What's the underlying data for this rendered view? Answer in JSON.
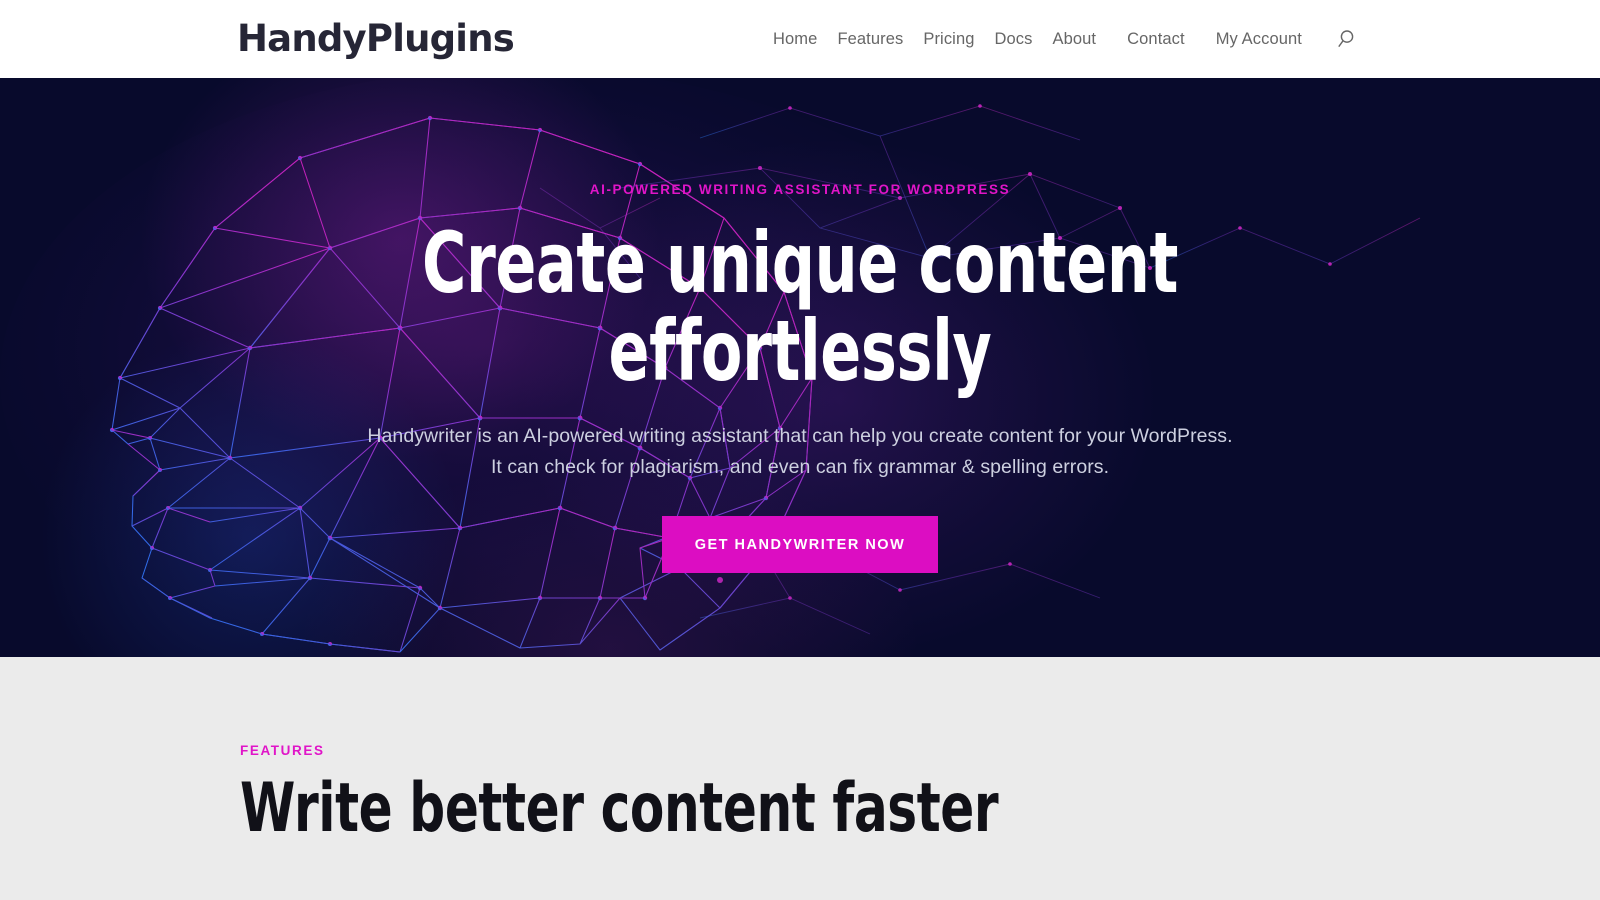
{
  "header": {
    "brand": "HandyPlugins",
    "nav": [
      {
        "label": "Home"
      },
      {
        "label": "Features"
      },
      {
        "label": "Pricing"
      },
      {
        "label": "Docs"
      },
      {
        "label": "About"
      },
      {
        "label": "Contact"
      },
      {
        "label": "My Account"
      }
    ],
    "search_icon": "search-icon"
  },
  "hero": {
    "eyebrow": "AI-POWERED WRITING ASSISTANT FOR WORDPRESS",
    "title_line1": "Create unique content",
    "title_line2": "effortlessly",
    "sub_line1": "Handywriter is an AI-powered writing assistant that can help you create content for your WordPress.",
    "sub_line2": "It can check for plagiarism, and even can fix grammar & spelling errors.",
    "cta_label": "GET HANDYWRITER NOW",
    "background_art": "low-poly-wireframe-human-head-profile"
  },
  "features": {
    "eyebrow": "FEATURES",
    "title": "Write better content faster"
  },
  "colors": {
    "accent_magenta": "#dc0dc2",
    "hero_background": "#080a2c",
    "section_background": "#ebebeb",
    "header_background": "#ffffff",
    "nav_text": "#666666",
    "brand_text": "#262636",
    "heading_dark": "#111118",
    "hero_heading": "#ffffff",
    "hero_sub_text": "#cdd0e0",
    "mesh_blue": "#2b7fff",
    "mesh_purple": "#8a3ad8",
    "mesh_magenta": "#d128c8"
  }
}
